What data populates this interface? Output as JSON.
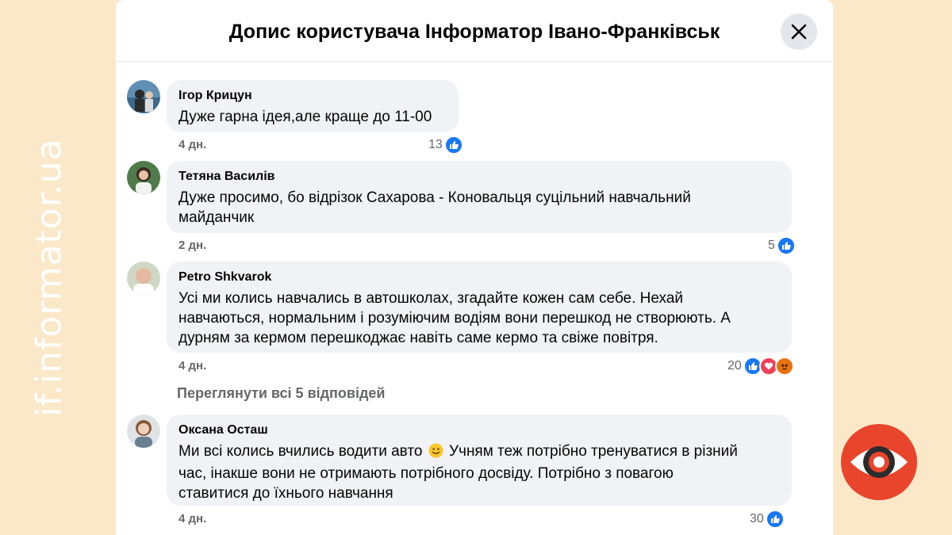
{
  "watermark": "if.informator.ua",
  "header": {
    "title": "Допис користувача Інформатор Івано-Франківськ"
  },
  "comments": [
    {
      "author": "Ігор Крицун",
      "text": "Дуже гарна ідея,але краще до 11-00",
      "time": "4 дн.",
      "reactions": "13"
    },
    {
      "author": "Тетяна Василів",
      "text_lines": [
        "Дуже просимо, бо відрізок Сахарова - Коновальця суцільний навчальний",
        "майданчик"
      ],
      "time": "2 дн.",
      "reactions": "5"
    },
    {
      "author": "Petro Shkvarok",
      "text_lines": [
        "Усі ми колись навчались в автошколах, згадайте кожен сам себе. Нехай",
        "навчаються, нормальним і розуміючим водіям вони перешкод не створюють. А",
        "дурням за кермом перешкоджає навіть саме кермо та свіже повітря."
      ],
      "time": "4 дн.",
      "reactions": "20"
    },
    {
      "author": "Оксана Осташ",
      "text_lines": [
        "Ми всі колись вчились водити авто",
        "Учням теж потрібно тренуватися в різний",
        "час, інакше вони не отримають потрібного досвіду. Потрібно з повагою",
        "ставитися до їхнього навчання"
      ],
      "time": "4 дн.",
      "reactions": "30"
    }
  ],
  "view_replies": "Переглянути всі 5 відповідей",
  "colors": {
    "like": "#1877f2",
    "love": "#f33e58",
    "angry": "#e9710f",
    "logo": "#e8452c"
  }
}
